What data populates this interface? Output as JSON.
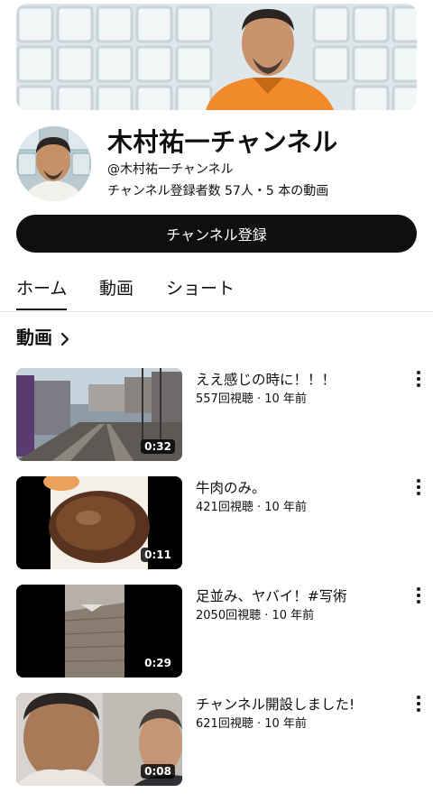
{
  "channel": {
    "name": "木村祐一チャンネル",
    "handle": "@木村祐一チャンネル",
    "meta": "チャンネル登録者数 57人・5 本の動画"
  },
  "subscribe": {
    "label": "チャンネル登録"
  },
  "tabs": [
    {
      "label": "ホーム",
      "active": true
    },
    {
      "label": "動画",
      "active": false
    },
    {
      "label": "ショート",
      "active": false
    }
  ],
  "section": {
    "title": "動画",
    "icon": "chevron-right-icon"
  },
  "videos": [
    {
      "title": "ええ感じの時に！！！",
      "meta": "557回視聴 · 10 年前",
      "duration": "0:32"
    },
    {
      "title": "牛肉のみ。",
      "meta": "421回視聴 · 10 年前",
      "duration": "0:11"
    },
    {
      "title": "足並み、ヤバイ！#写術",
      "meta": "2050回視聴 · 10 年前",
      "duration": "0:29"
    },
    {
      "title": "チャンネル開設しました!",
      "meta": "621回視聴 · 10 年前",
      "duration": "0:08"
    }
  ],
  "colors": {
    "primary_text": "#0f0f0f",
    "button_bg": "#0f0f0f",
    "button_text": "#ffffff",
    "shirt_orange": "#f08a2a"
  }
}
